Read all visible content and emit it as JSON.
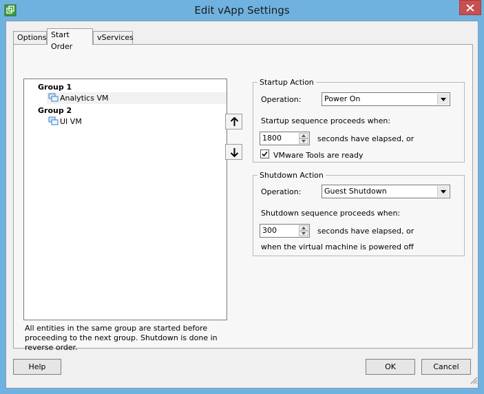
{
  "window": {
    "title": "Edit vApp Settings"
  },
  "tabs": [
    {
      "label": "Options"
    },
    {
      "label": "Start Order"
    },
    {
      "label": "vServices"
    }
  ],
  "tree": {
    "groups": [
      {
        "label": "Group 1",
        "vms": [
          "Analytics VM"
        ]
      },
      {
        "label": "Group 2",
        "vms": [
          "UI VM"
        ]
      }
    ]
  },
  "note": "All entities in the same group are started before proceeding to the next group. Shutdown is done in reverse order.",
  "startup": {
    "legend": "Startup Action",
    "operation_label": "Operation:",
    "operation_value": "Power On",
    "proceeds_label": "Startup sequence proceeds when:",
    "seconds_value": "1800",
    "seconds_label": "seconds have elapsed, or",
    "tools_label": "VMware Tools are ready",
    "tools_checked": true
  },
  "shutdown": {
    "legend": "Shutdown Action",
    "operation_label": "Operation:",
    "operation_value": "Guest Shutdown",
    "proceeds_label": "Shutdown sequence proceeds when:",
    "seconds_value": "300",
    "seconds_label": "seconds have elapsed, or",
    "powered_off_label": "when the virtual machine is powered off"
  },
  "buttons": {
    "help": "Help",
    "ok": "OK",
    "cancel": "Cancel"
  },
  "icons": {
    "app": "vapp-icon",
    "close": "close-icon",
    "vm": "vm-icon",
    "up": "arrow-up-icon",
    "down": "arrow-down-icon",
    "dropdown": "chevron-down-icon",
    "check": "checkmark-icon",
    "grip": "resize-grip-icon"
  },
  "colors": {
    "titlebar": "#6fb2e0",
    "close": "#c74f4f",
    "vm_icon": "#3a7fc0"
  }
}
